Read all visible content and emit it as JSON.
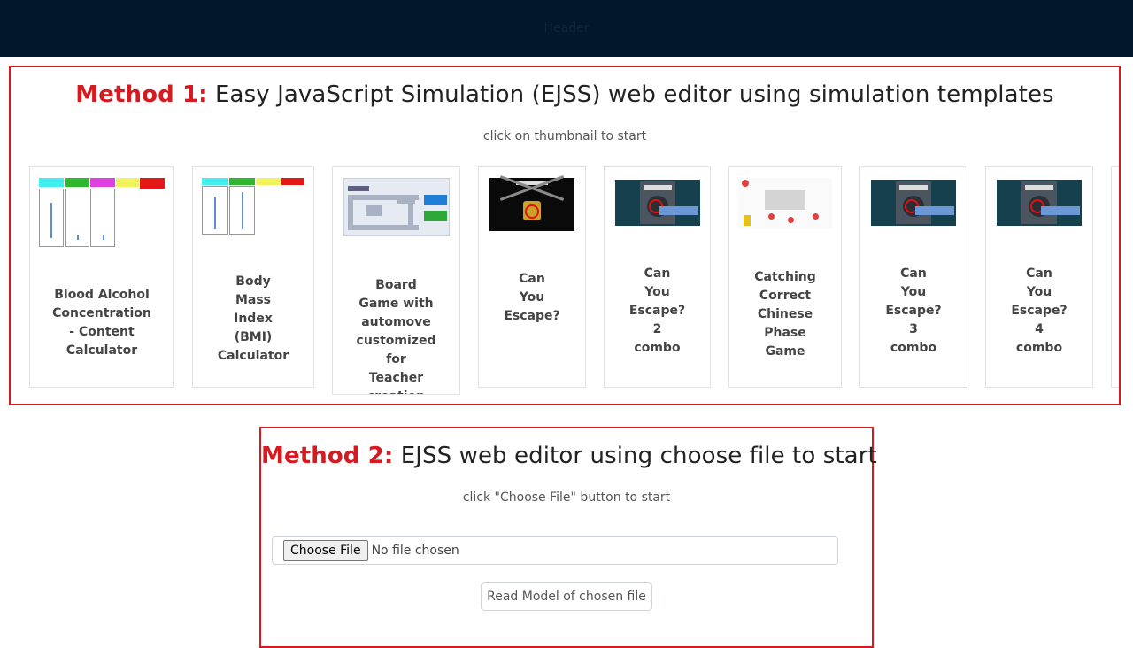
{
  "header": {
    "title": "Header"
  },
  "method1": {
    "title_prefix": "Method 1:",
    "title_rest": " Easy JavaScript Simulation (EJSS) web editor using simulation templates",
    "subtitle": "click on thumbnail to start",
    "cards": [
      {
        "label": "Blood Alcohol\nConcentration\n- Content\nCalculator",
        "icon": "bac-calculator-thumbnail"
      },
      {
        "label": "Body\nMass\nIndex\n(BMI)\nCalculator",
        "icon": "bmi-calculator-thumbnail"
      },
      {
        "label": "Board\nGame with\nautomove\ncustomized\nfor\nTeacher\ncreation",
        "icon": "board-game-thumbnail"
      },
      {
        "label": "Can\nYou\nEscape?",
        "icon": "can-you-escape-thumbnail"
      },
      {
        "label": "Can\nYou\nEscape?\n2\ncombo",
        "icon": "escape-2-combo-thumbnail"
      },
      {
        "label": "Catching\nCorrect\nChinese\nPhase\nGame",
        "icon": "chinese-phrase-game-thumbnail"
      },
      {
        "label": "Can\nYou\nEscape?\n3\ncombo",
        "icon": "escape-3-combo-thumbnail"
      },
      {
        "label": "Can\nYou\nEscape?\n4\ncombo",
        "icon": "escape-4-combo-thumbnail"
      }
    ]
  },
  "method2": {
    "title_prefix": "Method 2:",
    "title_rest": " EJSS web editor using choose file to start",
    "subtitle": "click \"Choose File\" button to start",
    "choose_file_label": "Choose File",
    "no_file_text": "No file chosen",
    "read_button_label": "Read Model of chosen file"
  },
  "colors": {
    "accent_red": "#d71a1f",
    "topbar": "#01172b"
  }
}
